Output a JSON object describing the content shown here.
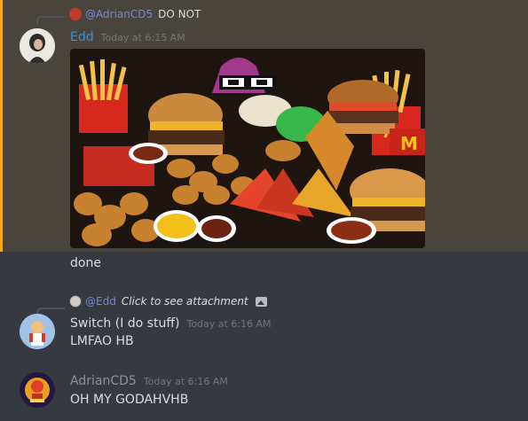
{
  "message_1": {
    "reply": {
      "mention": "@AdrianCD5",
      "content": "DO NOT"
    },
    "author": "Edd",
    "author_color": "#3c8fd6",
    "timestamp": "Today at 6:15 AM",
    "attachment_icon": "fast-food-image"
  },
  "message_1_followup": {
    "text": "done"
  },
  "message_2": {
    "reply": {
      "mention": "@Edd",
      "content": "Click to see attachment"
    },
    "author": "Switch (I do stuff)",
    "author_color": "#dcddde",
    "timestamp": "Today at 6:16 AM",
    "text": "LMFAO HB"
  },
  "message_3": {
    "author": "AdrianCD5",
    "author_color": "#8e9297",
    "timestamp": "Today at 6:16 AM",
    "text": "OH MY GODAHVHB"
  },
  "colors": {
    "background": "#36393f",
    "highlight": "#49443c",
    "highlight_border": "#faa81a",
    "mention": "#7289da"
  }
}
